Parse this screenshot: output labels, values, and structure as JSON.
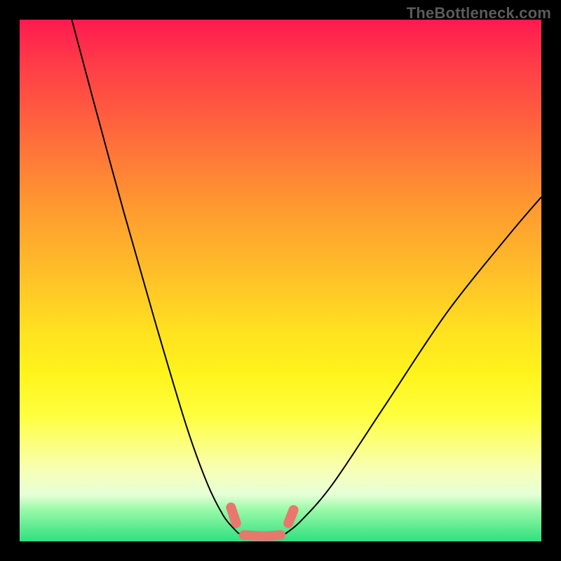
{
  "watermark": {
    "text": "TheBottleneck.com"
  },
  "chart_data": {
    "type": "line",
    "title": "",
    "xlabel": "",
    "ylabel": "",
    "xlim": [
      0,
      100
    ],
    "ylim": [
      0,
      100
    ],
    "grid": false,
    "description": "Bottleneck curve on a red-to-green vertical gradient. Two black spline curves descend from upper-left and upper-right, meeting in a shallow valley near the bottom center. A salmon marker at the bottom highlights the optimal match region.",
    "series": [
      {
        "name": "left-curve",
        "x": [
          10,
          14,
          20,
          26,
          32,
          36,
          39,
          41,
          42
        ],
        "y": [
          100,
          85,
          63,
          42,
          22,
          11,
          5,
          2.5,
          1.5
        ]
      },
      {
        "name": "valley-flat",
        "x": [
          42,
          45,
          48,
          51
        ],
        "y": [
          1.5,
          1.0,
          1.0,
          1.5
        ]
      },
      {
        "name": "right-curve",
        "x": [
          51,
          54,
          60,
          70,
          82,
          94,
          100
        ],
        "y": [
          1.5,
          4,
          11,
          26,
          44,
          59,
          66
        ]
      }
    ],
    "marker": {
      "name": "optimal-region",
      "color": "#e9776e",
      "segments": [
        {
          "x": [
            40.5,
            41.5
          ],
          "y": [
            6.5,
            3.5
          ]
        },
        {
          "x": [
            43,
            47,
            50
          ],
          "y": [
            1.2,
            1.0,
            1.2
          ]
        },
        {
          "x": [
            51.5,
            52.5
          ],
          "y": [
            3.5,
            6.0
          ]
        }
      ]
    }
  }
}
